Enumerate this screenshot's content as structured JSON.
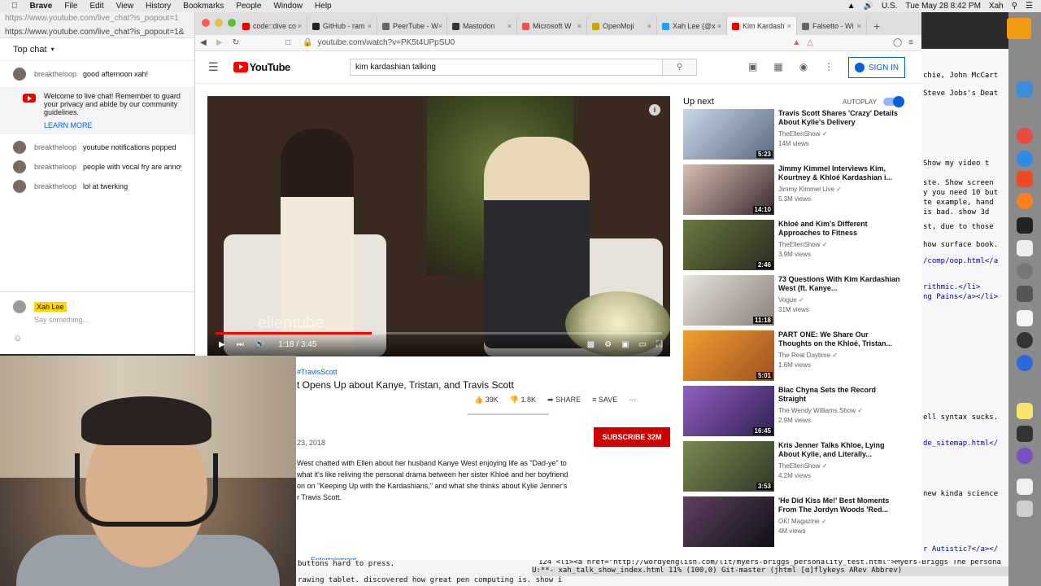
{
  "menubar": {
    "app": "Brave",
    "items": [
      "File",
      "Edit",
      "View",
      "History",
      "Bookmarks",
      "People",
      "Window",
      "Help"
    ],
    "input_source": "U.S.",
    "clock": "Tue May 28  8:42 PM",
    "user": "Xah"
  },
  "chat": {
    "window_title": "https://www.youtube.com/live_chat?is_popout=1",
    "url": "https://www.youtube.com/live_chat?is_popout=1&",
    "header": "Top chat",
    "messages": [
      {
        "author": "breaktheloop",
        "text": "good afternoon xah!"
      },
      {
        "author": "breaktheloop",
        "text": "youtube notifications popped"
      },
      {
        "author": "breaktheloop",
        "text": "people with vocal fry are annoying"
      },
      {
        "author": "breaktheloop",
        "text": "lol at twerking"
      }
    ],
    "system_message": "Welcome to live chat! Remember to guard your privacy and abide by our community guidelines.",
    "system_link": "LEARN MORE",
    "input_name": "Xah Lee",
    "input_placeholder": "Say something..."
  },
  "browser": {
    "tabs": [
      {
        "label": "code::dive co",
        "color": "#e00"
      },
      {
        "label": "GitHub - ram",
        "color": "#222"
      },
      {
        "label": "PeerTube - W",
        "color": "#666"
      },
      {
        "label": "Mastodon",
        "color": "#333"
      },
      {
        "label": "Microsoft W",
        "color": "#e55"
      },
      {
        "label": "OpenMoji",
        "color": "#c9a400"
      },
      {
        "label": "Xah Lee (@x",
        "color": "#1da1f2"
      },
      {
        "label": "Kim Kardash",
        "color": "#e00"
      },
      {
        "label": "Falsetto - Wi",
        "color": "#666"
      }
    ],
    "url": "youtube.com/watch?v=PK5t4UPpSU0"
  },
  "youtube": {
    "logo": "YouTube",
    "search_value": "kim kardashian talking",
    "signin": "SIGN IN",
    "video": {
      "watermark": "ellentube",
      "time": "1:18 / 3:45",
      "progress": 0.35,
      "hashtag": "#TravisScott",
      "title": "t Opens Up about Kanye, Tristan, and Travis Scott",
      "likes": "39K",
      "dislikes": "1.8K",
      "share": "SHARE",
      "save": "SAVE",
      "date": "23, 2018",
      "subscribe": "SUBSCRIBE  32M",
      "description_lines": [
        "West chatted with Ellen about her husband Kanye West enjoying life as \"Dad-ye\" to",
        "what it's like reliving the personal drama between her sister Khloé and her boyfriend",
        "on on \"Keeping Up with the Kardashians,\" and what she thinks about Kylie Jenner's",
        "r Travis Scott."
      ],
      "category": "Entertainment"
    },
    "upnext_label": "Up next",
    "autoplay_label": "AUTOPLAY",
    "recommendations": [
      {
        "title": "Travis Scott Shares 'Crazy' Details About Kylie's Delivery",
        "channel": "TheEllenShow",
        "views": "14M views",
        "duration": "5:23",
        "c1": "#c9d8e8",
        "c2": "#5a6a80"
      },
      {
        "title": "Jimmy Kimmel Interviews Kim, Kourtney & Khloé Kardashian i...",
        "channel": "Jimmy Kimmel Live",
        "views": "5.3M views",
        "duration": "14:10",
        "c1": "#d8c0b0",
        "c2": "#3a2a30"
      },
      {
        "title": "Khloé and Kim's Different Approaches to Fitness",
        "channel": "TheEllenShow",
        "views": "3.9M views",
        "duration": "2:46",
        "c1": "#6a7a40",
        "c2": "#2a2a20"
      },
      {
        "title": "73 Questions With Kim Kardashian West (ft. Kanye...",
        "channel": "Vogue",
        "views": "31M views",
        "duration": "11:18",
        "c1": "#e8e4de",
        "c2": "#8a8078"
      },
      {
        "title": "PART ONE: We Share Our Thoughts on the Khloé, Tristan...",
        "channel": "The Real Daytime",
        "views": "1.6M views",
        "duration": "5:01",
        "c1": "#f0a030",
        "c2": "#a05020"
      },
      {
        "title": "Blac Chyna Sets the Record Straight",
        "channel": "The Wendy Williams Show",
        "views": "2.9M views",
        "duration": "16:45",
        "c1": "#9060c0",
        "c2": "#302050"
      },
      {
        "title": "Kris Jenner Talks Khloe, Lying About Kylie, and Literally...",
        "channel": "TheEllenShow",
        "views": "4.2M views",
        "duration": "3:53",
        "c1": "#7a8a50",
        "c2": "#303828"
      },
      {
        "title": "'He Did Kiss Me!' Best Moments From The Jordyn Woods 'Red...",
        "channel": "OK! Magazine",
        "views": "4M views",
        "duration": "",
        "c1": "#604060",
        "c2": "#101018"
      }
    ]
  },
  "emacs": {
    "lines": [
      "chie, John McCart",
      "Steve Jobs's Deat",
      "Show my video t",
      "ste. Show screen",
      "y you need 10 but",
      "te example, hand",
      "is bad. show 3d",
      "st, due to those",
      "how surface book.",
      "/comp/oop.html</a",
      "rithmic.</li>",
      "ng Pains</a></li>",
      "ell syntax sucks.",
      "de_sitemap.html</",
      "new kinda science",
      "r Autistic?</a></"
    ],
    "bottom_line1": "buttons hard to press.",
    "bottom_line2": "rawing tablet. discovered how great pen computing is. show i",
    "code_line": "124 <li><a href=\"http://wordyenglish.com/lit/myers-briggs_personality_test.html\">Myers-Briggs The persona",
    "modeline": "U:**-  xah_talk_show_index.html   11% (100,0)   Git-master  (jhtml [α]flykeys ARev Abbrev)"
  }
}
